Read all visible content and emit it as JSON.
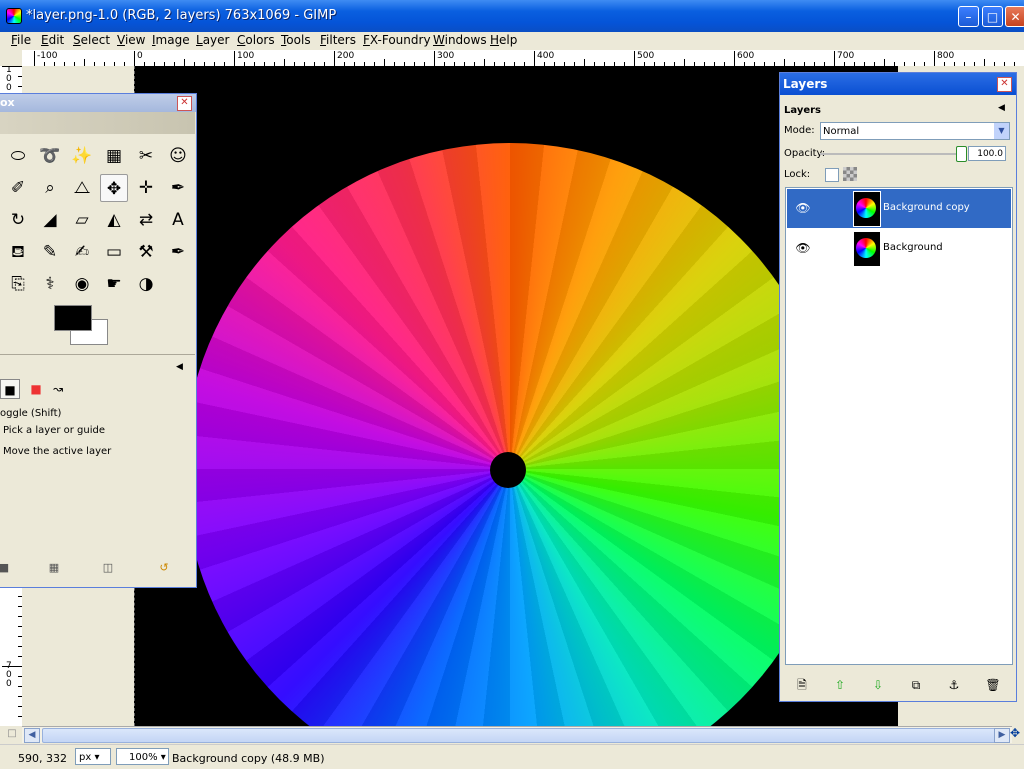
{
  "window": {
    "title": "*layer.png-1.0 (RGB, 2 layers) 763x1069 - GIMP",
    "buttons": {
      "minimize": "–",
      "maximize": "□",
      "close": "✕"
    }
  },
  "menubar": [
    "File",
    "Edit",
    "Select",
    "View",
    "Image",
    "Layer",
    "Colors",
    "Tools",
    "Filters",
    "FX-Foundry",
    "Windows",
    "Help"
  ],
  "ruler": {
    "h_labels": [
      "-100",
      "0",
      "100",
      "200",
      "300",
      "400",
      "500",
      "600",
      "700",
      "800"
    ],
    "v_labels": [
      "100",
      "700"
    ]
  },
  "toolbox": {
    "title": "ox",
    "tools": [
      {
        "name": "rect-select-icon",
        "glyph": "⬭"
      },
      {
        "name": "free-select-icon",
        "glyph": "➰"
      },
      {
        "name": "fuzzy-select-icon",
        "glyph": "✨"
      },
      {
        "name": "select-by-color-icon",
        "glyph": "▦"
      },
      {
        "name": "scissors-icon",
        "glyph": "✂"
      },
      {
        "name": "foreground-select-icon",
        "glyph": "☺"
      },
      {
        "name": "color-picker-icon",
        "glyph": "✐"
      },
      {
        "name": "zoom-icon",
        "glyph": "⌕"
      },
      {
        "name": "measure-icon",
        "glyph": "⧍"
      },
      {
        "name": "move-icon",
        "glyph": "✥"
      },
      {
        "name": "align-icon",
        "glyph": "✛"
      },
      {
        "name": "crop-icon",
        "glyph": "✒"
      },
      {
        "name": "rotate-icon",
        "glyph": "↻"
      },
      {
        "name": "scale-icon",
        "glyph": "◢"
      },
      {
        "name": "shear-icon",
        "glyph": "▱"
      },
      {
        "name": "perspective-icon",
        "glyph": "◭"
      },
      {
        "name": "flip-icon",
        "glyph": "⇄"
      },
      {
        "name": "text-icon",
        "glyph": "A"
      },
      {
        "name": "bucket-fill-icon",
        "glyph": "⛾"
      },
      {
        "name": "pencil-icon",
        "glyph": "✎"
      },
      {
        "name": "paintbrush-icon",
        "glyph": "✍"
      },
      {
        "name": "eraser-icon",
        "glyph": "▭"
      },
      {
        "name": "airbrush-icon",
        "glyph": "⚒"
      },
      {
        "name": "ink-icon",
        "glyph": "✒"
      },
      {
        "name": "clone-icon",
        "glyph": "⎘"
      },
      {
        "name": "heal-icon",
        "glyph": "⚕"
      },
      {
        "name": "blur-icon",
        "glyph": "◉"
      },
      {
        "name": "smudge-icon",
        "glyph": "☛"
      },
      {
        "name": "dodge-burn-icon",
        "glyph": "◑"
      }
    ],
    "options_text": {
      "toggle": "oggle  (Shift)",
      "pick": "Pick a layer or guide",
      "move": "Move the active layer"
    }
  },
  "layers": {
    "title": "Layers",
    "subtitle": "Layers",
    "mode_label": "Mode:",
    "mode_value": "Normal",
    "opacity_label": "Opacity:",
    "opacity_value": "100.0",
    "opacity_fraction": 1.0,
    "lock_label": "Lock:",
    "items": [
      {
        "name": "Background copy",
        "selected": true,
        "visible": true
      },
      {
        "name": "Background",
        "selected": false,
        "visible": true
      }
    ]
  },
  "statusbar": {
    "coords": "590, 332",
    "unit": "px",
    "zoom": "100%",
    "layer_info": "Background copy (48.9 MB)"
  },
  "colors": {
    "accent": "#316ac5",
    "titlebar": "#0a5fe0",
    "canvas_bg": "#000000"
  }
}
